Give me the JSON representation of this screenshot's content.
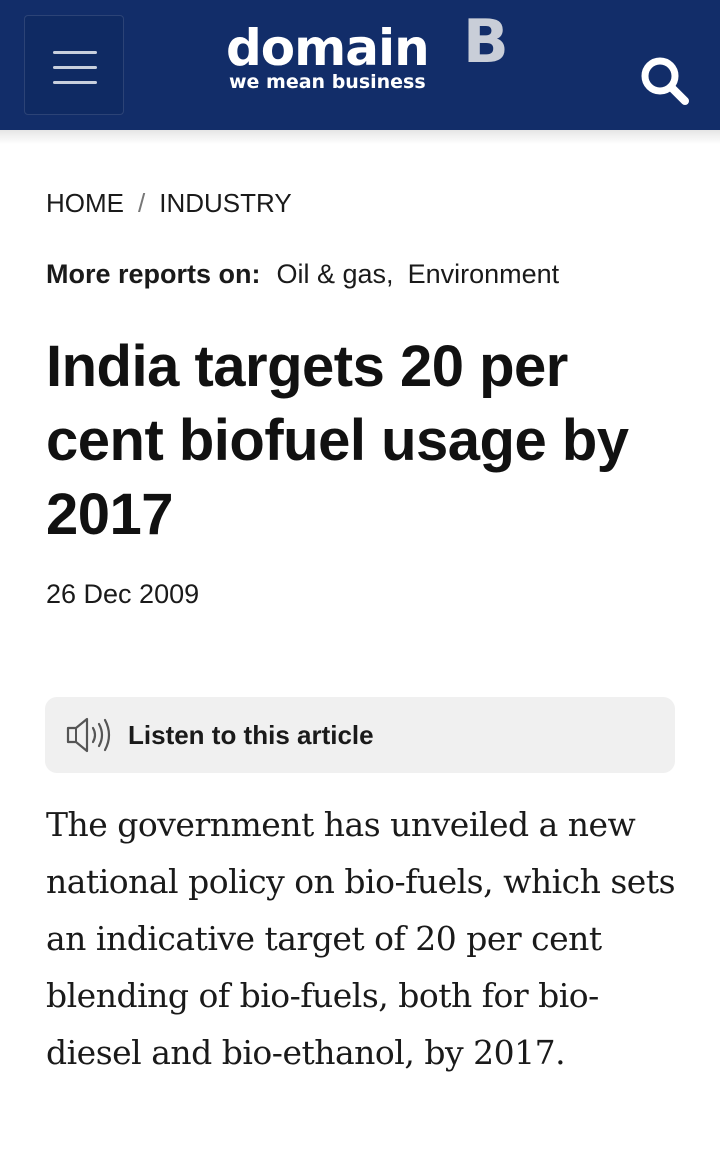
{
  "header": {
    "logo_word": "domain",
    "logo_letter": "B",
    "logo_tagline": "we mean business",
    "menu_icon": "hamburger-menu-icon",
    "search_icon": "search-icon",
    "bg_color": "#122d69"
  },
  "breadcrumb": {
    "items": [
      "HOME",
      "INDUSTRY"
    ],
    "separator": "/"
  },
  "reports": {
    "label": "More reports on:",
    "tags": [
      "Oil & gas,",
      "Environment"
    ]
  },
  "article": {
    "title": "India targets 20 per cent biofuel usage by 2017",
    "date": "26 Dec 2009",
    "listen_label": "Listen to this article",
    "listen_icon": "speaker-icon",
    "body": "The government has unveiled a new national policy on bio-fuels, which sets an indicative target of 20 per cent blending of bio-fuels, both for bio-diesel and bio-ethanol, by 2017."
  }
}
